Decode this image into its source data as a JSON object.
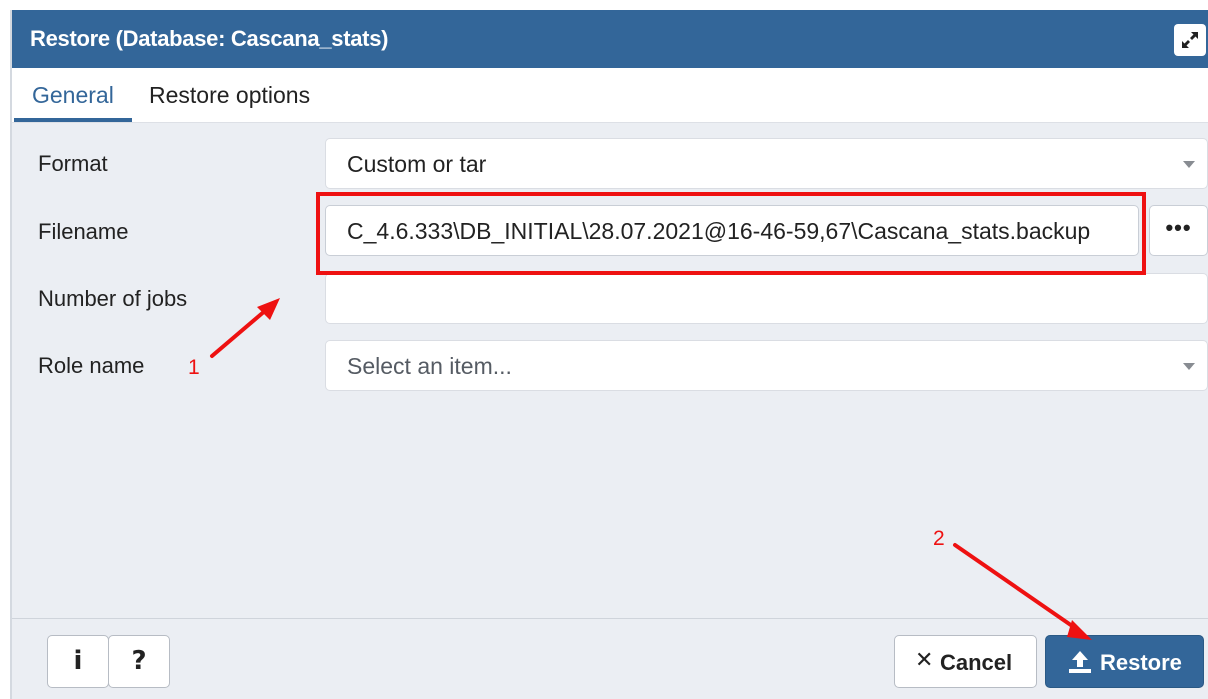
{
  "dialog": {
    "title": "Restore (Database: Cascana_stats)",
    "icons": {
      "maximize": "maximize-icon"
    }
  },
  "tabs": [
    {
      "label": "General",
      "active": true
    },
    {
      "label": "Restore options",
      "active": false
    }
  ],
  "form": {
    "format": {
      "label": "Format",
      "value": "Custom or tar"
    },
    "filename": {
      "label": "Filename",
      "value": "C_4.6.333\\DB_INITIAL\\28.07.2021@16-46-59,67\\Cascana_stats.backup",
      "browse_label": "•••"
    },
    "jobs": {
      "label": "Number of jobs",
      "value": ""
    },
    "role": {
      "label": "Role name",
      "placeholder": "Select an item..."
    }
  },
  "footer": {
    "info_label": "i",
    "help_label": "?",
    "cancel_label": "Cancel",
    "restore_label": "Restore"
  },
  "annotations": {
    "marker_1": "1",
    "marker_2": "2",
    "color": "#ee1111"
  },
  "colors": {
    "accent": "#336699",
    "panel_bg": "#ebeef3"
  }
}
